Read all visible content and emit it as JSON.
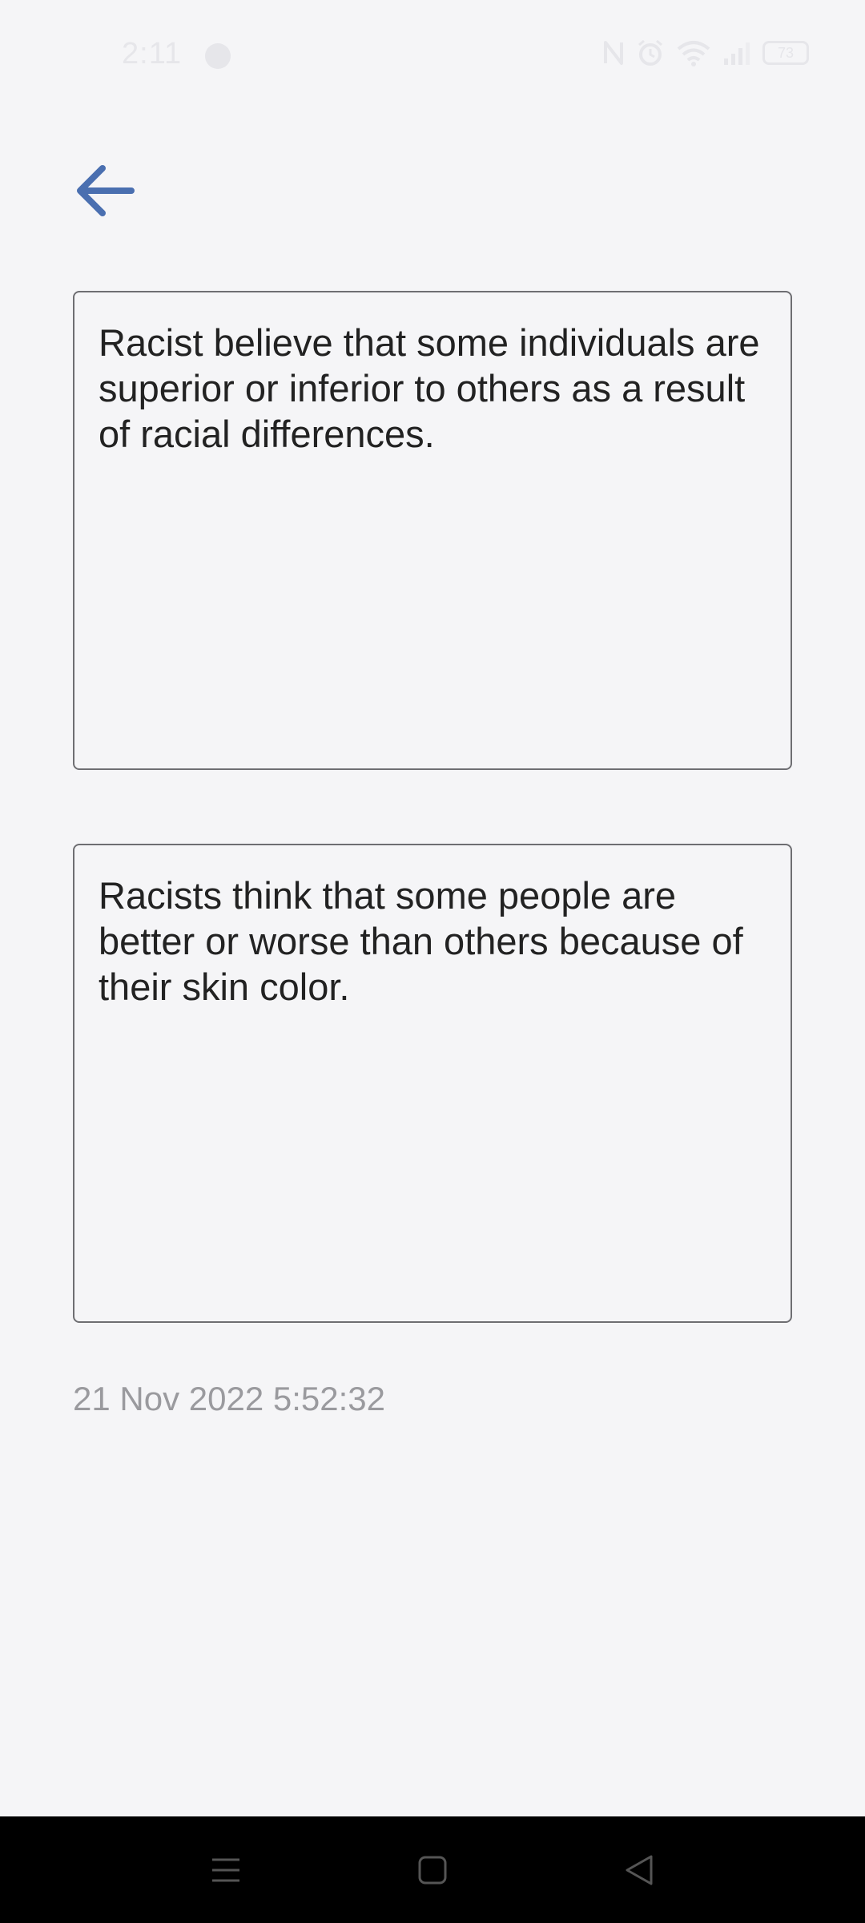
{
  "status_bar": {
    "time": "2:11",
    "battery": "73",
    "icons": [
      "messenger-icon",
      "nfc-icon",
      "alarm-icon",
      "wifi-icon",
      "signal-icon",
      "battery-icon"
    ]
  },
  "header": {
    "back_icon": "arrow-left-icon"
  },
  "cards": [
    {
      "text": "Racist believe that some individuals are superior or inferior to others as a result of racial differences."
    },
    {
      "text": "Racists think that some people are better or worse than others because of their skin color."
    }
  ],
  "timestamp": "21 Nov 2022 5:52:32",
  "colors": {
    "background": "#f5f5f7",
    "accent": "#4a6fb0",
    "border": "#6e6e72",
    "timestamp": "#9a9a9e",
    "nav_bar": "#000000"
  },
  "nav_bar": {
    "icons": [
      "menu-icon",
      "home-icon",
      "back-triangle-icon"
    ]
  }
}
